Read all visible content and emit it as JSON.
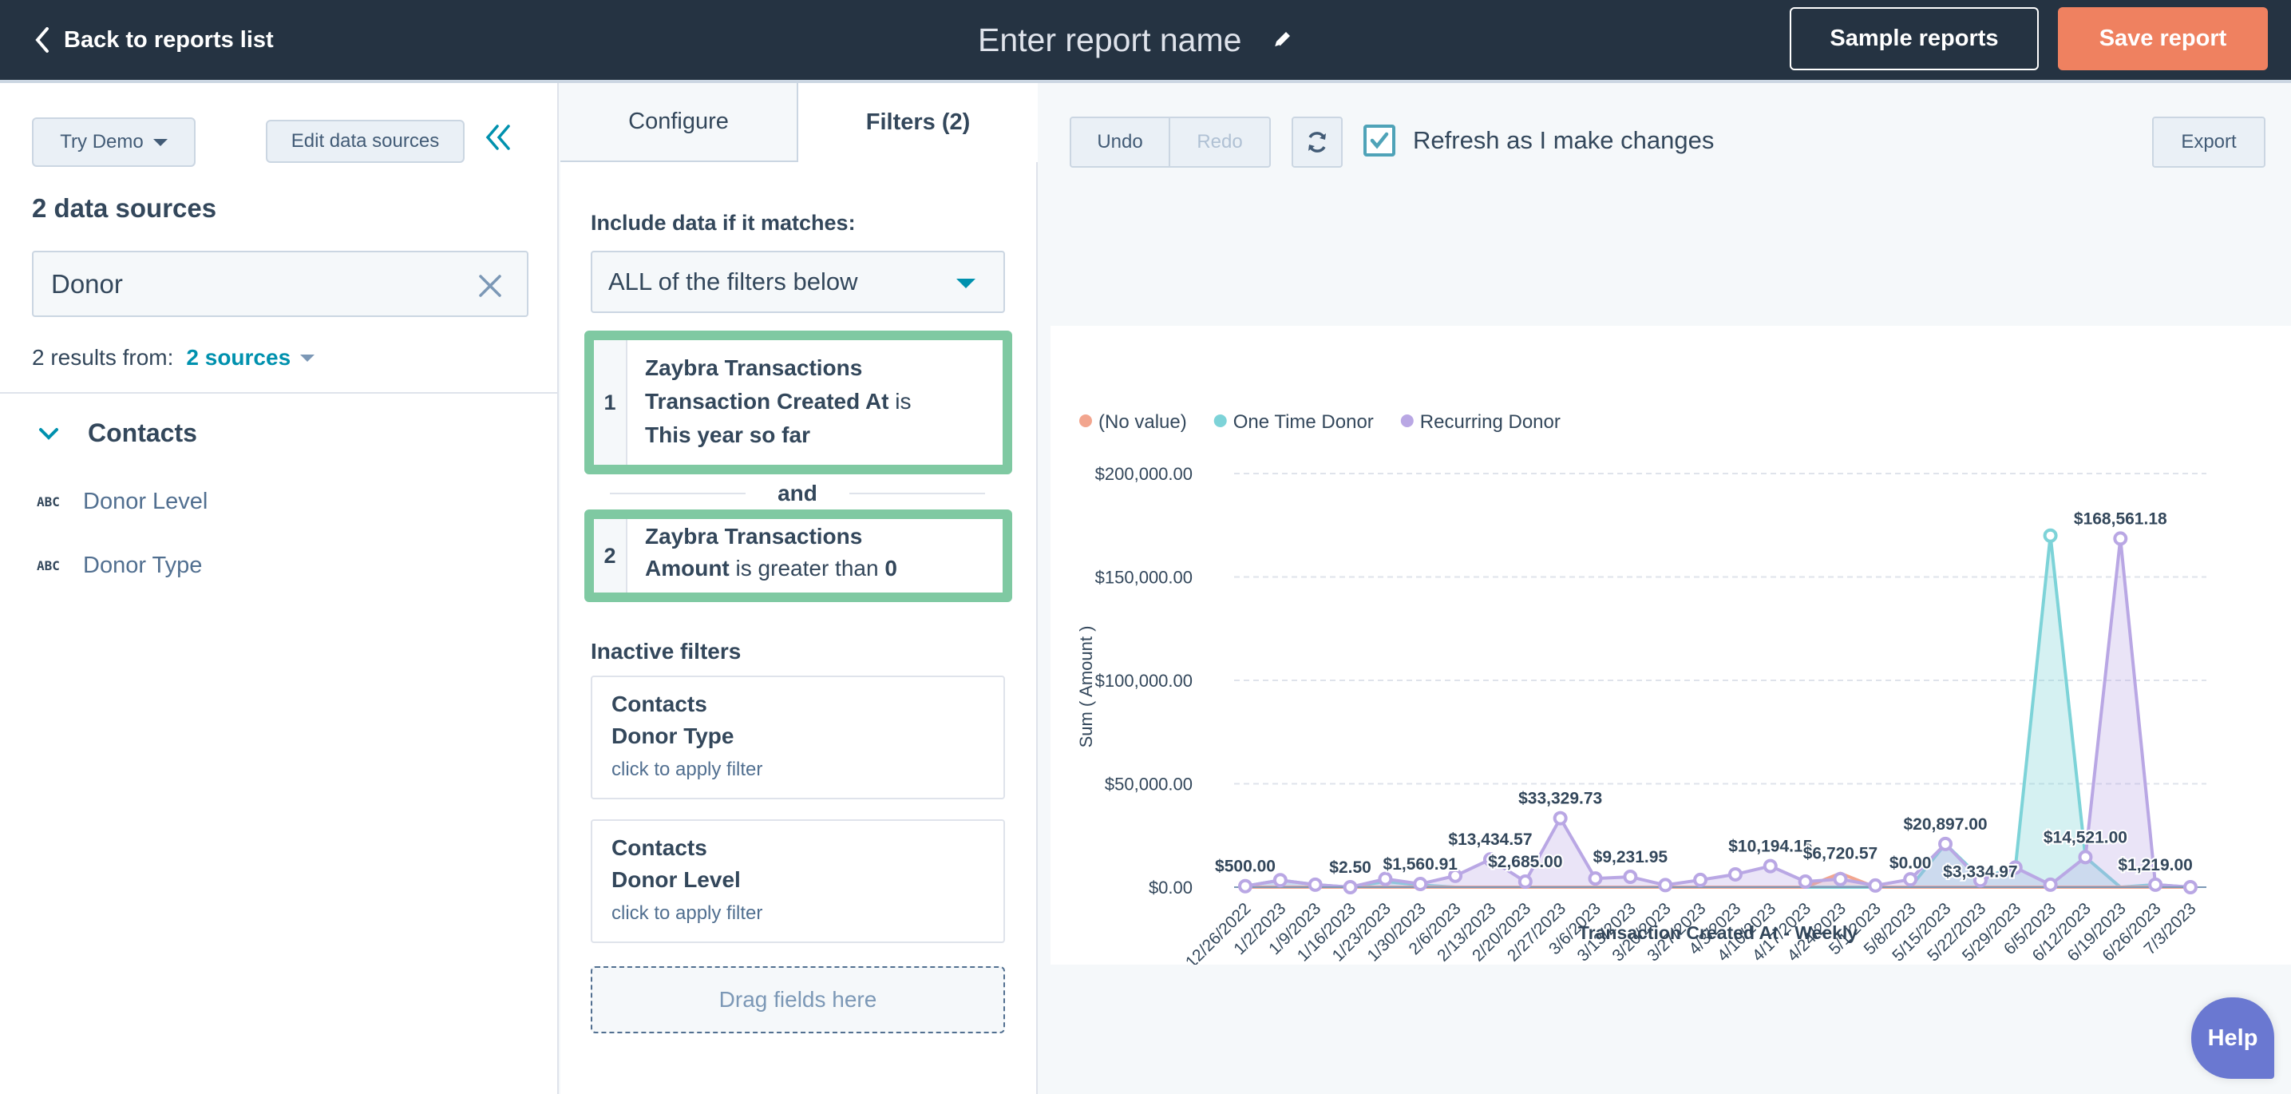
{
  "header": {
    "back_label": "Back to reports list",
    "report_name_placeholder": "Enter report name",
    "sample_reports_label": "Sample reports",
    "save_report_label": "Save report"
  },
  "left_panel": {
    "try_demo_label": "Try Demo",
    "edit_sources_label": "Edit data sources",
    "data_sources_title": "2 data sources",
    "search_value": "Donor",
    "results_prefix": "2 results from:",
    "results_sources_link": "2 sources",
    "group": {
      "label": "Contacts",
      "fields": [
        {
          "type_icon": "ABC",
          "label": "Donor Level"
        },
        {
          "type_icon": "ABC",
          "label": "Donor Type"
        }
      ]
    }
  },
  "middle_panel": {
    "tabs": [
      {
        "label": "Configure",
        "active": false
      },
      {
        "label": "Filters (2)",
        "active": true
      }
    ],
    "include_label": "Include data if it matches:",
    "match_select_value": "ALL of the filters below",
    "active_filters": [
      {
        "number": "1",
        "object": "Zaybra Transactions",
        "property": "Transaction Created At",
        "operator": "is",
        "value": "This year so far"
      },
      {
        "number": "2",
        "object": "Zaybra Transactions",
        "property": "Amount",
        "operator": "is greater than",
        "value": "0"
      }
    ],
    "conjunction": "and",
    "inactive_label": "Inactive filters",
    "inactive_filters": [
      {
        "object": "Contacts",
        "property": "Donor Type",
        "hint": "click to apply filter"
      },
      {
        "object": "Contacts",
        "property": "Donor Level",
        "hint": "click to apply filter"
      }
    ],
    "dropzone_label": "Drag fields here"
  },
  "toolbar": {
    "undo_label": "Undo",
    "redo_label": "Redo",
    "refresh_checkbox_label": "Refresh as I make changes",
    "refresh_checked": true,
    "export_label": "Export"
  },
  "help_label": "Help",
  "colors": {
    "header_bg": "#253342",
    "save_button": "#ef8160",
    "accent_teal": "#0091ae",
    "filter_border": "#7fc9a2",
    "no_value": "#f2a58e",
    "one_time": "#7dd3d8",
    "recurring": "#b9a7e4"
  },
  "chart_data": {
    "type": "area",
    "title": "",
    "xlabel": "Transaction Created At - Weekly",
    "ylabel": "Sum ( Amount )",
    "ylim": [
      0,
      200000
    ],
    "yticks": [
      "$0.00",
      "$50,000.00",
      "$100,000.00",
      "$150,000.00",
      "$200,000.00"
    ],
    "ytick_values": [
      0,
      50000,
      100000,
      150000,
      200000
    ],
    "grid": true,
    "legend_position": "top-left",
    "categories": [
      "12/26/2022",
      "1/2/2023",
      "1/9/2023",
      "1/16/2023",
      "1/23/2023",
      "1/30/2023",
      "2/6/2023",
      "2/13/2023",
      "2/20/2023",
      "2/27/2023",
      "3/6/2023",
      "3/13/2023",
      "3/20/2023",
      "3/27/2023",
      "4/3/2023",
      "4/10/2023",
      "4/17/2023",
      "4/24/2023",
      "5/1/2023",
      "5/8/2023",
      "5/15/2023",
      "5/22/2023",
      "5/29/2023",
      "6/5/2023",
      "6/12/2023",
      "6/19/2023",
      "6/26/2023",
      "7/3/2023"
    ],
    "series": [
      {
        "name": "(No value)",
        "color": "#f2a58e",
        "values": [
          0,
          0,
          0,
          0,
          0,
          0,
          0,
          0,
          0,
          0,
          0,
          0,
          0,
          0,
          0,
          0,
          0,
          6720.57,
          0,
          0,
          0,
          0,
          0,
          0,
          0,
          0,
          0,
          0
        ]
      },
      {
        "name": "One Time Donor",
        "color": "#7dd3d8",
        "values": [
          500,
          3400,
          1200,
          0,
          2800,
          1000,
          0,
          0,
          0,
          0,
          0,
          0,
          0,
          0,
          0,
          0,
          0,
          0,
          0,
          0,
          20897,
          4500,
          9500,
          170000,
          14521,
          0,
          1219,
          0
        ]
      },
      {
        "name": "Recurring Donor",
        "color": "#b9a7e4",
        "values": [
          500,
          3400,
          1200,
          2.5,
          4000,
          1560.91,
          5500,
          13434.57,
          2685,
          33329.73,
          4200,
          5000,
          1000,
          3500,
          6200,
          10194.15,
          2700,
          3900,
          800,
          3800,
          20897,
          3334.97,
          9500,
          1200,
          14521,
          168561.18,
          1219,
          0
        ]
      }
    ],
    "data_labels": [
      {
        "category": "12/26/2022",
        "text": "$500.00"
      },
      {
        "category": "1/16/2023",
        "text": "$2.50"
      },
      {
        "category": "1/30/2023",
        "text": "$1,560.91"
      },
      {
        "category": "2/13/2023",
        "text": "$13,434.57"
      },
      {
        "category": "2/20/2023",
        "text": "$2,685.00"
      },
      {
        "category": "2/27/2023",
        "text": "$33,329.73"
      },
      {
        "category": "3/13/2023",
        "text": "$9,231.95"
      },
      {
        "category": "4/10/2023",
        "text": "$10,194.15"
      },
      {
        "category": "4/24/2023",
        "text": "$6,720.57"
      },
      {
        "category": "5/8/2023",
        "text": "$0.00"
      },
      {
        "category": "5/15/2023",
        "text": "$20,897.00"
      },
      {
        "category": "5/22/2023",
        "text": "$3,334.97"
      },
      {
        "category": "6/12/2023",
        "text": "$14,521.00"
      },
      {
        "category": "6/19/2023",
        "text": "$168,561.18"
      },
      {
        "category": "6/26/2023",
        "text": "$1,219.00"
      }
    ]
  }
}
